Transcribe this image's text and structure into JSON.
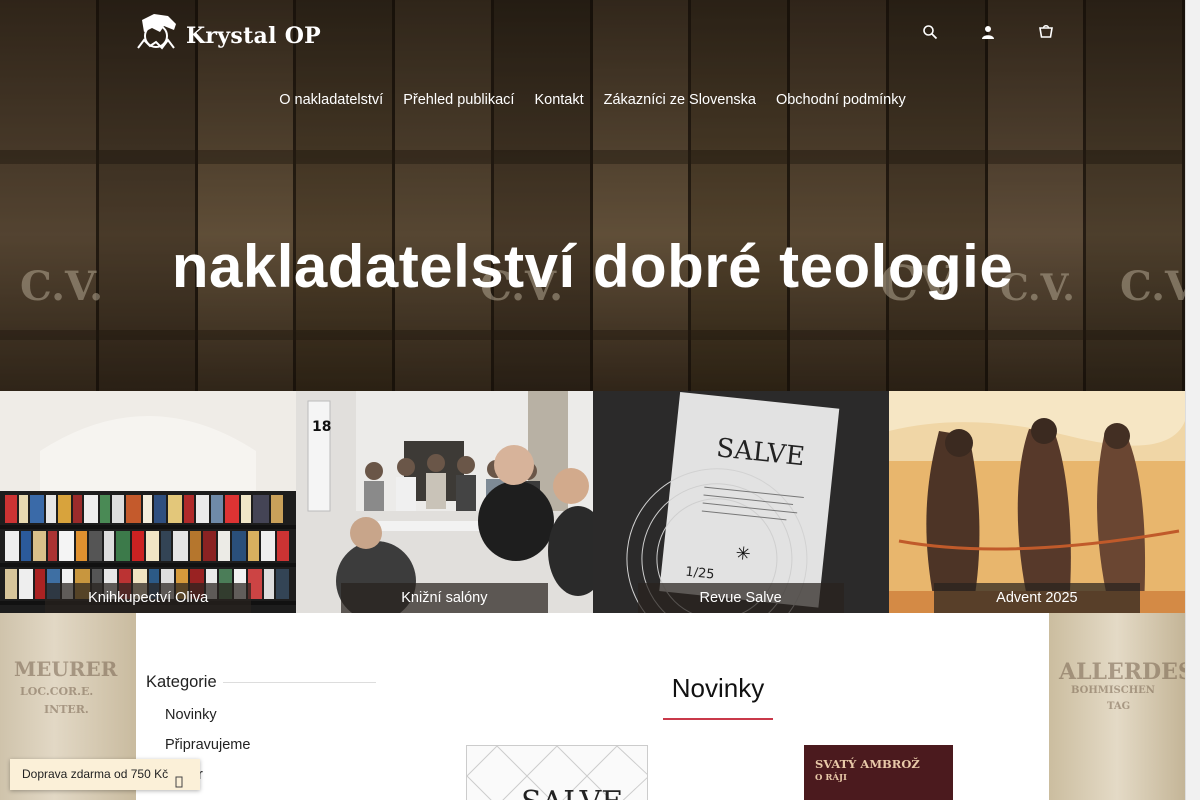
{
  "brand": {
    "logo_text": "Krystal OP",
    "logo_icon": "lion-seal-icon"
  },
  "header": {
    "icons": [
      "search-icon",
      "user-icon",
      "cart-icon"
    ],
    "nav": [
      {
        "label": "O nakladatelství"
      },
      {
        "label": "Přehled publikací"
      },
      {
        "label": "Kontakt"
      },
      {
        "label": "Zákazníci ze Slovenska"
      },
      {
        "label": "Obchodní podmínky"
      }
    ]
  },
  "hero": {
    "title": "nakladatelství dobré teologie",
    "spine_texts": [
      "C.V.",
      "C.V.",
      "CV",
      "C.V.",
      "C.V."
    ]
  },
  "tiles": [
    {
      "caption": "Knihkupectví Oliva"
    },
    {
      "caption": "Knižní salóny"
    },
    {
      "caption": "Revue Salve",
      "cover_title": "SALVE",
      "cover_issue": "1/25"
    },
    {
      "caption": "Advent 2025"
    }
  ],
  "sidebar": {
    "heading": "Kategorie",
    "items": [
      {
        "label": "Novinky"
      },
      {
        "label": "Připravujeme"
      },
      {
        "label": "Bazar"
      }
    ]
  },
  "main": {
    "section_title": "Novinky",
    "books": [
      {
        "cover_title": "SALVE"
      },
      {
        "cover_title": "SVATÝ AMBROŽ",
        "cover_subtitle": "O RÁJI"
      }
    ]
  },
  "shipping_banner": {
    "text": "Doprava zdarma od 750 Kč"
  },
  "colors": {
    "accent": "#c9394a",
    "banner_bg": "#fbf0d8"
  }
}
